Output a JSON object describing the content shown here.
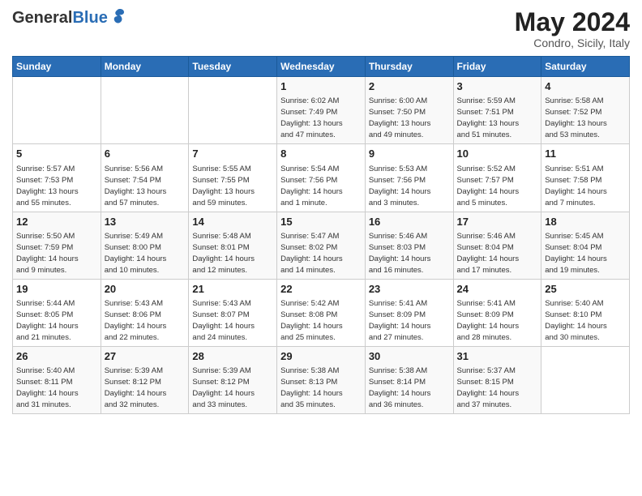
{
  "header": {
    "logo_general": "General",
    "logo_blue": "Blue",
    "month_year": "May 2024",
    "location": "Condro, Sicily, Italy"
  },
  "days_of_week": [
    "Sunday",
    "Monday",
    "Tuesday",
    "Wednesday",
    "Thursday",
    "Friday",
    "Saturday"
  ],
  "weeks": [
    [
      {
        "day": "",
        "info": ""
      },
      {
        "day": "",
        "info": ""
      },
      {
        "day": "",
        "info": ""
      },
      {
        "day": "1",
        "info": "Sunrise: 6:02 AM\nSunset: 7:49 PM\nDaylight: 13 hours\nand 47 minutes."
      },
      {
        "day": "2",
        "info": "Sunrise: 6:00 AM\nSunset: 7:50 PM\nDaylight: 13 hours\nand 49 minutes."
      },
      {
        "day": "3",
        "info": "Sunrise: 5:59 AM\nSunset: 7:51 PM\nDaylight: 13 hours\nand 51 minutes."
      },
      {
        "day": "4",
        "info": "Sunrise: 5:58 AM\nSunset: 7:52 PM\nDaylight: 13 hours\nand 53 minutes."
      }
    ],
    [
      {
        "day": "5",
        "info": "Sunrise: 5:57 AM\nSunset: 7:53 PM\nDaylight: 13 hours\nand 55 minutes."
      },
      {
        "day": "6",
        "info": "Sunrise: 5:56 AM\nSunset: 7:54 PM\nDaylight: 13 hours\nand 57 minutes."
      },
      {
        "day": "7",
        "info": "Sunrise: 5:55 AM\nSunset: 7:55 PM\nDaylight: 13 hours\nand 59 minutes."
      },
      {
        "day": "8",
        "info": "Sunrise: 5:54 AM\nSunset: 7:56 PM\nDaylight: 14 hours\nand 1 minute."
      },
      {
        "day": "9",
        "info": "Sunrise: 5:53 AM\nSunset: 7:56 PM\nDaylight: 14 hours\nand 3 minutes."
      },
      {
        "day": "10",
        "info": "Sunrise: 5:52 AM\nSunset: 7:57 PM\nDaylight: 14 hours\nand 5 minutes."
      },
      {
        "day": "11",
        "info": "Sunrise: 5:51 AM\nSunset: 7:58 PM\nDaylight: 14 hours\nand 7 minutes."
      }
    ],
    [
      {
        "day": "12",
        "info": "Sunrise: 5:50 AM\nSunset: 7:59 PM\nDaylight: 14 hours\nand 9 minutes."
      },
      {
        "day": "13",
        "info": "Sunrise: 5:49 AM\nSunset: 8:00 PM\nDaylight: 14 hours\nand 10 minutes."
      },
      {
        "day": "14",
        "info": "Sunrise: 5:48 AM\nSunset: 8:01 PM\nDaylight: 14 hours\nand 12 minutes."
      },
      {
        "day": "15",
        "info": "Sunrise: 5:47 AM\nSunset: 8:02 PM\nDaylight: 14 hours\nand 14 minutes."
      },
      {
        "day": "16",
        "info": "Sunrise: 5:46 AM\nSunset: 8:03 PM\nDaylight: 14 hours\nand 16 minutes."
      },
      {
        "day": "17",
        "info": "Sunrise: 5:46 AM\nSunset: 8:04 PM\nDaylight: 14 hours\nand 17 minutes."
      },
      {
        "day": "18",
        "info": "Sunrise: 5:45 AM\nSunset: 8:04 PM\nDaylight: 14 hours\nand 19 minutes."
      }
    ],
    [
      {
        "day": "19",
        "info": "Sunrise: 5:44 AM\nSunset: 8:05 PM\nDaylight: 14 hours\nand 21 minutes."
      },
      {
        "day": "20",
        "info": "Sunrise: 5:43 AM\nSunset: 8:06 PM\nDaylight: 14 hours\nand 22 minutes."
      },
      {
        "day": "21",
        "info": "Sunrise: 5:43 AM\nSunset: 8:07 PM\nDaylight: 14 hours\nand 24 minutes."
      },
      {
        "day": "22",
        "info": "Sunrise: 5:42 AM\nSunset: 8:08 PM\nDaylight: 14 hours\nand 25 minutes."
      },
      {
        "day": "23",
        "info": "Sunrise: 5:41 AM\nSunset: 8:09 PM\nDaylight: 14 hours\nand 27 minutes."
      },
      {
        "day": "24",
        "info": "Sunrise: 5:41 AM\nSunset: 8:09 PM\nDaylight: 14 hours\nand 28 minutes."
      },
      {
        "day": "25",
        "info": "Sunrise: 5:40 AM\nSunset: 8:10 PM\nDaylight: 14 hours\nand 30 minutes."
      }
    ],
    [
      {
        "day": "26",
        "info": "Sunrise: 5:40 AM\nSunset: 8:11 PM\nDaylight: 14 hours\nand 31 minutes."
      },
      {
        "day": "27",
        "info": "Sunrise: 5:39 AM\nSunset: 8:12 PM\nDaylight: 14 hours\nand 32 minutes."
      },
      {
        "day": "28",
        "info": "Sunrise: 5:39 AM\nSunset: 8:12 PM\nDaylight: 14 hours\nand 33 minutes."
      },
      {
        "day": "29",
        "info": "Sunrise: 5:38 AM\nSunset: 8:13 PM\nDaylight: 14 hours\nand 35 minutes."
      },
      {
        "day": "30",
        "info": "Sunrise: 5:38 AM\nSunset: 8:14 PM\nDaylight: 14 hours\nand 36 minutes."
      },
      {
        "day": "31",
        "info": "Sunrise: 5:37 AM\nSunset: 8:15 PM\nDaylight: 14 hours\nand 37 minutes."
      },
      {
        "day": "",
        "info": ""
      }
    ]
  ]
}
